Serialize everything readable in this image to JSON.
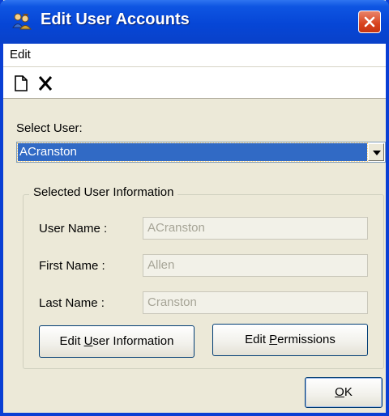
{
  "window": {
    "title": "Edit User Accounts"
  },
  "menu": {
    "edit_label": "Edit"
  },
  "toolbar": {
    "icons": [
      "new-document-icon",
      "delete-icon"
    ]
  },
  "select_user": {
    "label": "Select User:",
    "value": "ACranston"
  },
  "group": {
    "title": "Selected User Information",
    "fields": [
      {
        "label": "User Name :",
        "value": "ACranston"
      },
      {
        "label": "First Name :",
        "value": "Allen"
      },
      {
        "label": "Last Name :",
        "value": "Cranston"
      }
    ]
  },
  "buttons": {
    "edit_info_pre": "Edit ",
    "edit_info_mnemonic": "U",
    "edit_info_post": "ser Information",
    "edit_perm_pre": "Edit ",
    "edit_perm_mnemonic": "P",
    "edit_perm_post": "ermissions",
    "ok_mnemonic": "O",
    "ok_post": "K"
  },
  "colors": {
    "title_bar": "#0646d6",
    "selection": "#316ac5",
    "close_button": "#d8431e"
  }
}
